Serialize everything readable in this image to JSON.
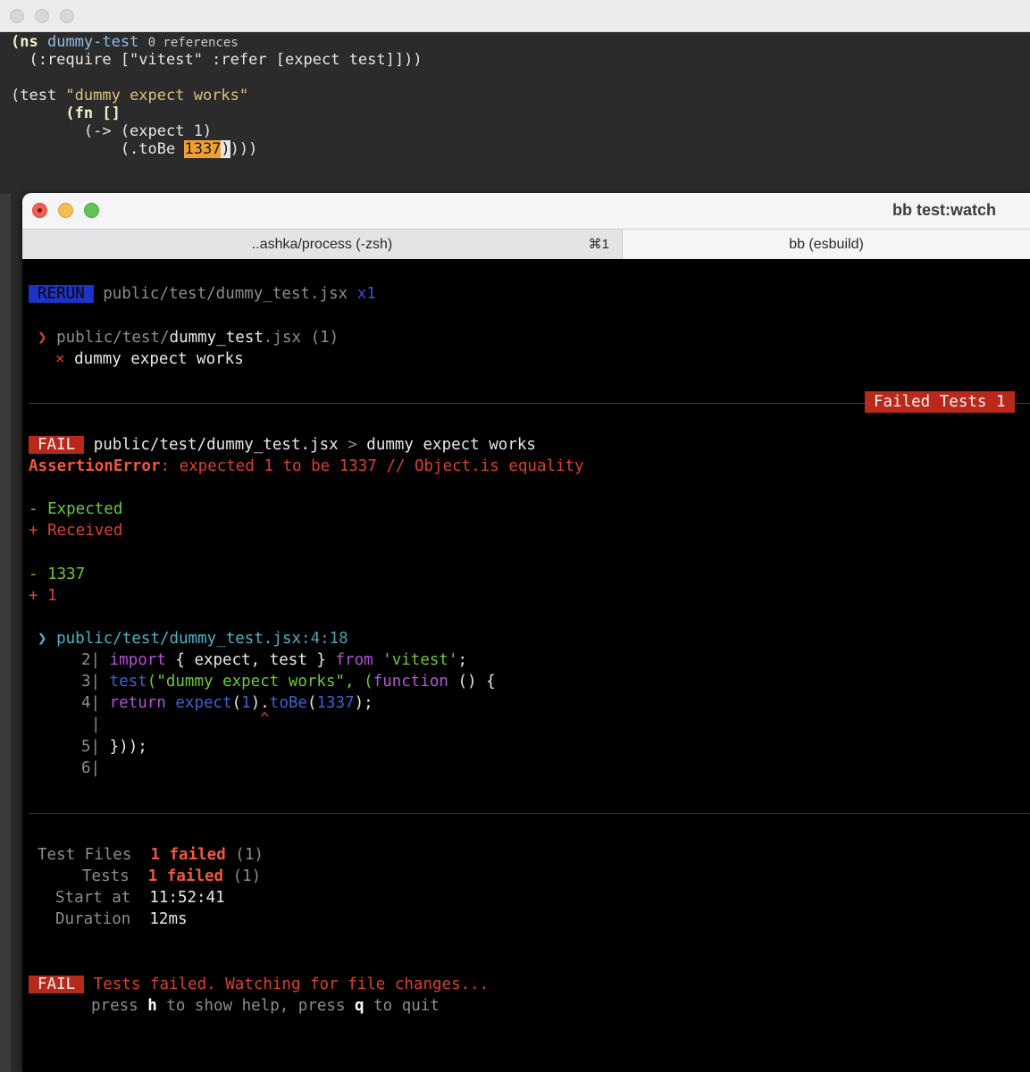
{
  "editor": {
    "lines": {
      "l1_ns": "(ns",
      "l1_name": "dummy-test",
      "l1_refs": "0 references",
      "l2": "  (:require [\"vitest\" :refer [expect test]]))",
      "l3_open": "(test ",
      "l3_str": "\"dummy expect works\"",
      "l4": "      (fn []",
      "l5": "        (-> (expect 1)",
      "l6_pre": "            (.toBe ",
      "l6_num": "1337",
      "l6_cur": ")",
      "l6_post": ")))"
    }
  },
  "terminal": {
    "title": "bb test:watch",
    "tabs": [
      {
        "label": "..ashka/process (-zsh)",
        "shortcut": "⌘1"
      },
      {
        "label": "bb (esbuild)"
      }
    ],
    "rerun": {
      "badge": "RERUN",
      "path": "public/test/dummy_test.jsx",
      "count": "x1"
    },
    "file_summary": {
      "arrow": "❯",
      "dir": "public/test/",
      "file": "dummy_test",
      "ext": ".jsx",
      "count": "(1)"
    },
    "test_case": {
      "mark": "×",
      "name": "dummy expect works"
    },
    "failed_tests_badge": "Failed Tests 1",
    "fail_header": {
      "badge": "FAIL",
      "path": "public/test/dummy_test.jsx",
      "sep": ">",
      "name": "dummy expect works"
    },
    "assertion": {
      "type": "AssertionError",
      "message": ": expected 1 to be 1337 // Object.is equality"
    },
    "diff": {
      "expected_label": "- Expected",
      "received_label": "+ Received",
      "expected_value": "- 1337",
      "received_value": "+ 1"
    },
    "location": {
      "arrow": "❯",
      "path": "public/test/dummy_test.jsx",
      "pos": ":4:18"
    },
    "code": [
      {
        "num": "2|",
        "parts": [
          "import",
          " { expect, test } ",
          "from",
          " ",
          "'vitest'",
          ";"
        ]
      },
      {
        "num": "3|",
        "parts": [
          "test",
          "(\"dummy expect works\", (",
          "function",
          " () {"
        ]
      },
      {
        "num": "4|",
        "parts": [
          "return",
          " ",
          "expect",
          "(",
          "1",
          ").",
          "toBe",
          "(",
          "1337",
          ");"
        ]
      },
      {
        "num": "|",
        "caret": "^"
      },
      {
        "num": "5|",
        "parts": [
          "}));"
        ]
      },
      {
        "num": "6|",
        "parts": []
      }
    ],
    "summary": {
      "test_files_label": "Test Files",
      "test_files_value": "1 failed",
      "test_files_count": "(1)",
      "tests_label": "Tests",
      "tests_value": "1 failed",
      "tests_count": "(1)",
      "start_label": "Start at",
      "start_value": "11:52:41",
      "duration_label": "Duration",
      "duration_value": "12ms"
    },
    "footer": {
      "badge": "FAIL",
      "message": "Tests failed. Watching for file changes...",
      "press1": "press ",
      "key_h": "h",
      "press2": " to show help, press ",
      "key_q": "q",
      "press3": " to quit"
    },
    "colors": {
      "fail_red": "#b8291b",
      "rerun_blue": "#1d32c6",
      "green": "#6bc83f",
      "red_text": "#d9412e"
    }
  }
}
